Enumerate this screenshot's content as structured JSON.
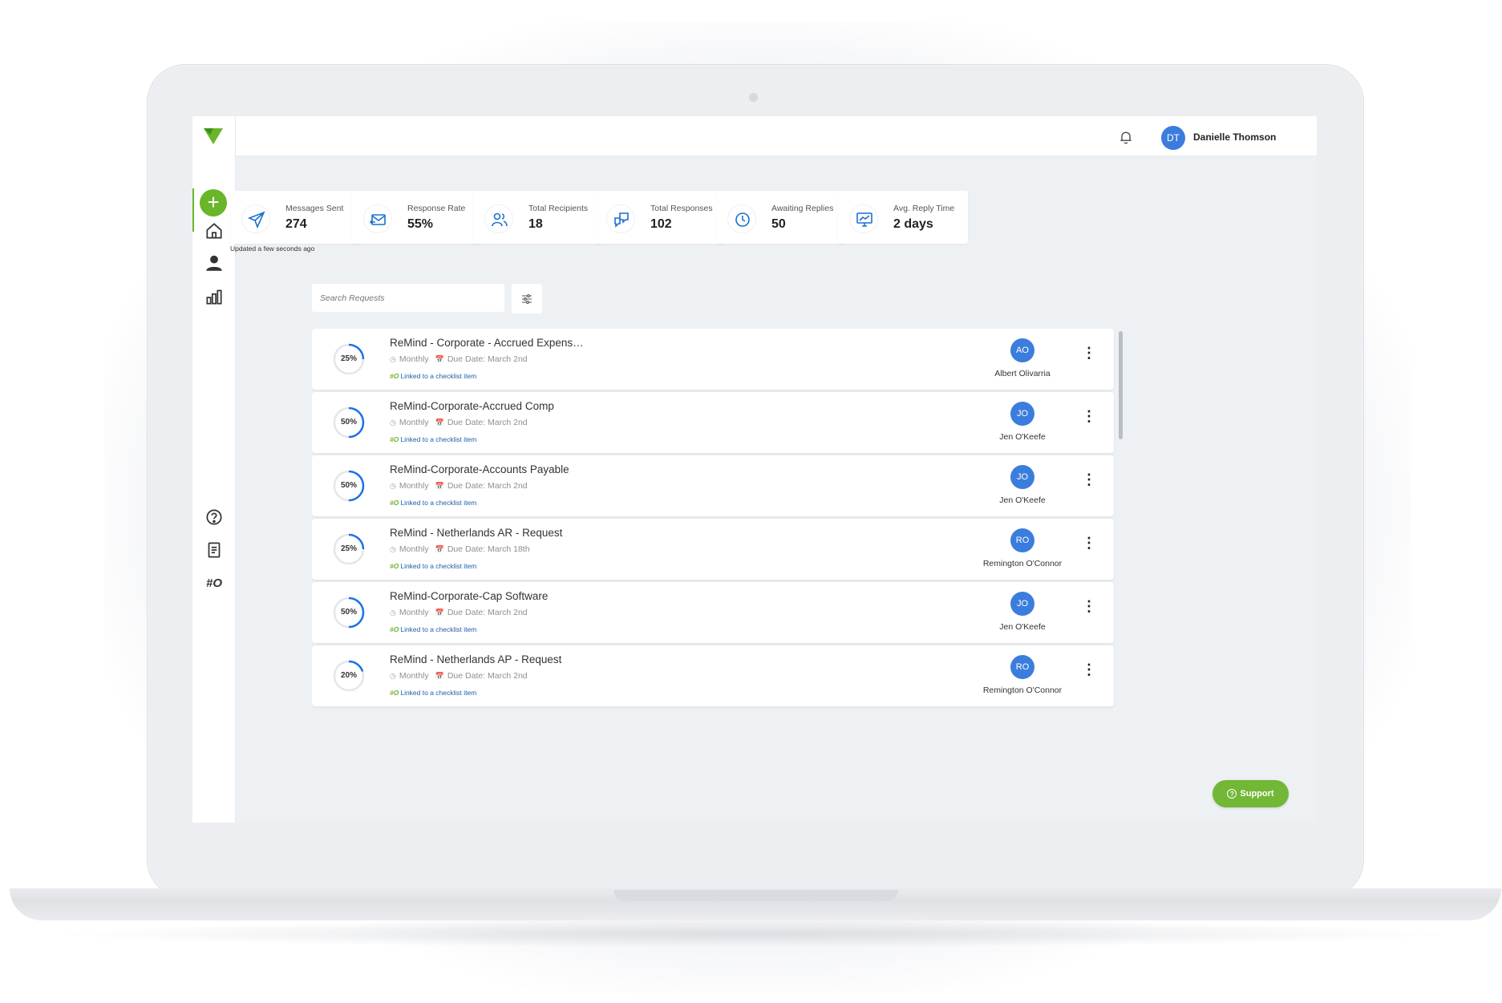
{
  "header": {
    "user_initials": "DT",
    "user_name": "Danielle Thomson"
  },
  "kpis": [
    {
      "label": "Messages Sent",
      "value": "274",
      "icon": "send-icon"
    },
    {
      "label": "Response Rate",
      "value": "55%",
      "icon": "envelope-return-icon"
    },
    {
      "label": "Total Recipients",
      "value": "18",
      "icon": "users-icon"
    },
    {
      "label": "Total Responses",
      "value": "102",
      "icon": "chat-bubbles-icon"
    },
    {
      "label": "Awaiting Replies",
      "value": "50",
      "icon": "clock-icon"
    },
    {
      "label": "Avg. Reply Time",
      "value": "2 days",
      "icon": "monitor-chart-icon"
    }
  ],
  "updated_text": "Updated a few seconds ago",
  "search": {
    "placeholder": "Search Requests"
  },
  "requests": [
    {
      "title": "ReMind - Corporate - Accrued Expens…",
      "progress": "25%",
      "progress_value": 0.25,
      "frequency": "Monthly",
      "due": "Due Date: March 2nd",
      "link": "Linked to a checklist item",
      "initials": "AO",
      "assignee": "Albert Olivarria"
    },
    {
      "title": "ReMind-Corporate-Accrued Comp",
      "progress": "50%",
      "progress_value": 0.5,
      "frequency": "Monthly",
      "due": "Due Date: March 2nd",
      "link": "Linked to a checklist item",
      "initials": "JO",
      "assignee": "Jen O'Keefe"
    },
    {
      "title": "ReMind-Corporate-Accounts Payable",
      "progress": "50%",
      "progress_value": 0.5,
      "frequency": "Monthly",
      "due": "Due Date: March 2nd",
      "link": "Linked to a checklist item",
      "initials": "JO",
      "assignee": "Jen O'Keefe"
    },
    {
      "title": "ReMind - Netherlands AR - Request",
      "progress": "25%",
      "progress_value": 0.25,
      "frequency": "Monthly",
      "due": "Due Date: March 18th",
      "link": "Linked to a checklist item",
      "initials": "RO",
      "assignee": "Remington O'Connor"
    },
    {
      "title": "ReMind-Corporate-Cap Software",
      "progress": "50%",
      "progress_value": 0.5,
      "frequency": "Monthly",
      "due": "Due Date: March 2nd",
      "link": "Linked to a checklist item",
      "initials": "JO",
      "assignee": "Jen O'Keefe"
    },
    {
      "title": "ReMind - Netherlands AP - Request",
      "progress": "20%",
      "progress_value": 0.2,
      "frequency": "Monthly",
      "due": "Due Date: March 2nd",
      "link": "Linked to a checklist item",
      "initials": "RO",
      "assignee": "Remington O'Connor"
    }
  ],
  "link_prefix": "#O",
  "sidebar_hash": "#O",
  "support_label": "Support",
  "colors": {
    "accent_green": "#6ab52a",
    "avatar_blue": "#3b7ddd",
    "progress_blue": "#1a73e8",
    "link_blue": "#1e5fa8"
  }
}
